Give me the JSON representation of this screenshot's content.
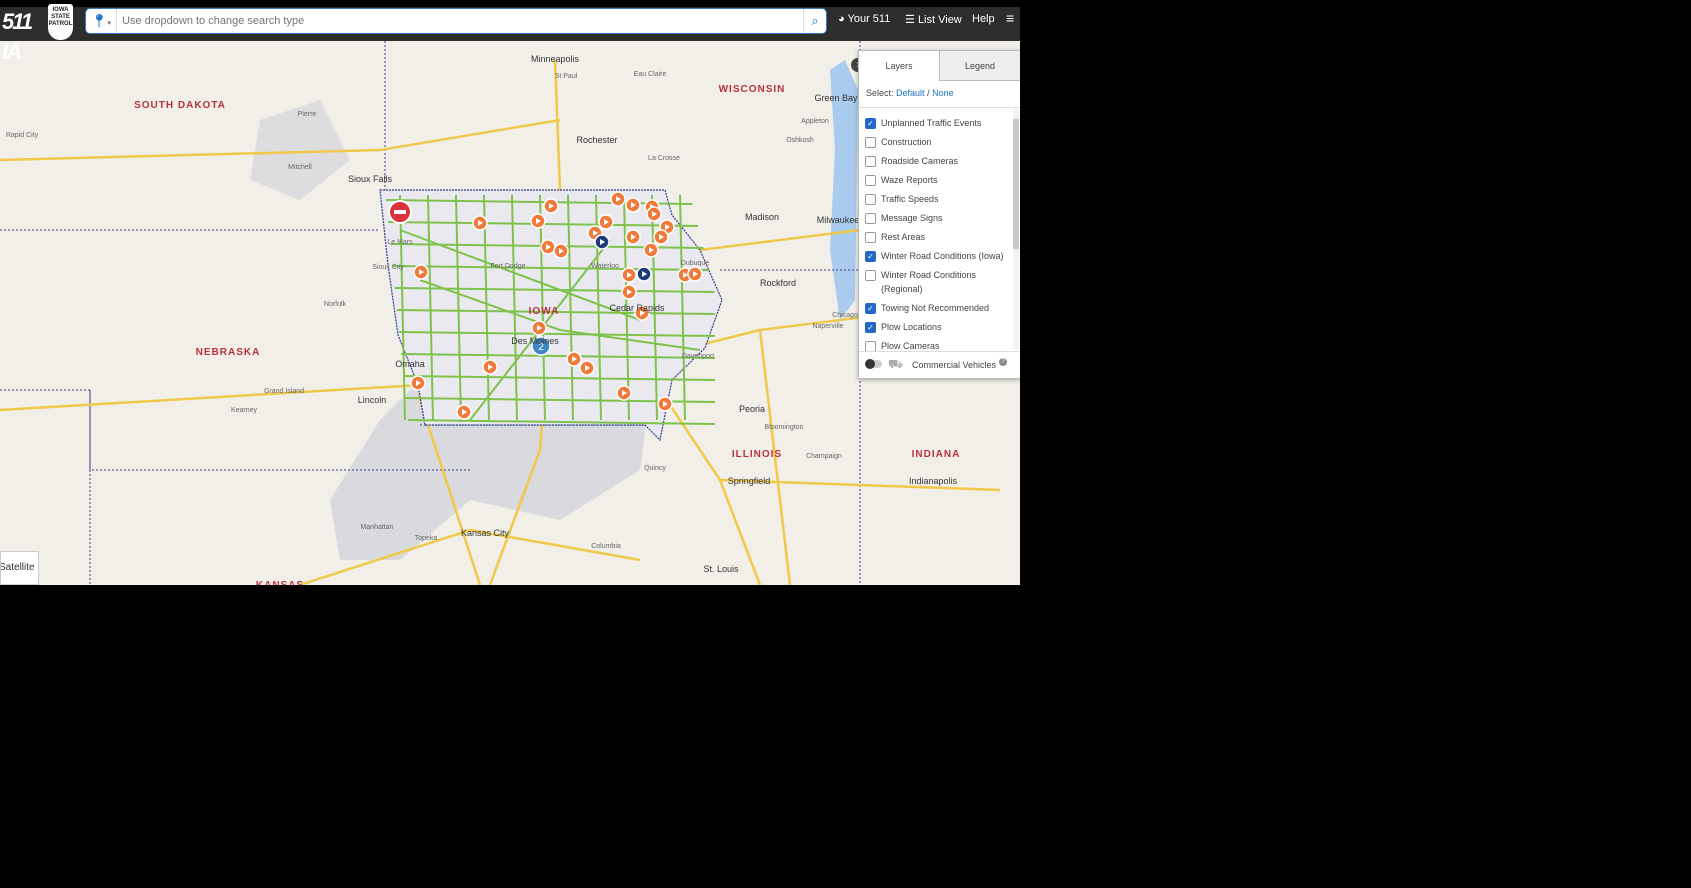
{
  "header": {
    "logo": "511 IA",
    "patrol_logo": "IOWA STATE PATROL",
    "search_placeholder": "Use dropdown to change search type",
    "your511": "Your 511",
    "list_view": "List View",
    "help": "Help"
  },
  "map": {
    "states": [
      {
        "t": "SOUTH DAKOTA",
        "k": "sd"
      },
      {
        "t": "NEBRASKA",
        "k": "ne"
      },
      {
        "t": "WISCONSIN",
        "k": "wi"
      },
      {
        "t": "IOWA",
        "k": "ia"
      },
      {
        "t": "ILLINOIS",
        "k": "il"
      },
      {
        "t": "INDIANA",
        "k": "in"
      },
      {
        "t": "KANSAS",
        "k": "ks"
      }
    ],
    "cities": [
      "Minneapolis",
      "St Paul",
      "Sioux Falls",
      "Rochester",
      "Eau Claire",
      "Green Bay",
      "Appleton",
      "Oshkosh",
      "Madison",
      "Milwaukee",
      "Rockford",
      "Chicago",
      "Naperville",
      "Sioux City",
      "Fort Dodge",
      "Waterloo",
      "Dubuque",
      "Cedar Rapids",
      "Davenport",
      "Des Moines",
      "Omaha",
      "Lincoln",
      "Grand Island",
      "Peoria",
      "Springfield",
      "Champaign",
      "Bloomington",
      "Kansas City",
      "Topeka",
      "Manhattan",
      "Columbia",
      "St. Louis",
      "Indianapolis",
      "Rapid City",
      "Pierre",
      "Mitchell",
      "Le Mars",
      "Norfolk",
      "Kearney",
      "Quincy",
      "La Crosse"
    ],
    "cluster_count": "2",
    "satellite_label": "Satellite",
    "colors": {
      "road_condition": "#7ec24b",
      "event": "#ef7a3a",
      "plow": "#1f3c78",
      "closure": "#d9343a"
    }
  },
  "panel": {
    "tabs": [
      "Layers",
      "Legend"
    ],
    "select_label": "Select:",
    "select_default": "Default",
    "select_sep": "/",
    "select_none": "None",
    "layers": [
      {
        "label": "Unplanned Traffic Events",
        "checked": true
      },
      {
        "label": "Construction",
        "checked": false
      },
      {
        "label": "Roadside Cameras",
        "checked": false
      },
      {
        "label": "Waze Reports",
        "checked": false
      },
      {
        "label": "Traffic Speeds",
        "checked": false
      },
      {
        "label": "Message Signs",
        "checked": false
      },
      {
        "label": "Rest Areas",
        "checked": false
      },
      {
        "label": "Winter Road Conditions (Iowa)",
        "checked": true
      },
      {
        "label": "Winter Road Conditions (Regional)",
        "checked": false
      },
      {
        "label": "Towing Not Recommended",
        "checked": true
      },
      {
        "label": "Plow Locations",
        "checked": true
      },
      {
        "label": "Plow Cameras",
        "checked": false
      }
    ],
    "commercial_vehicles": "Commercial Vehicles",
    "commercial_on": false
  }
}
